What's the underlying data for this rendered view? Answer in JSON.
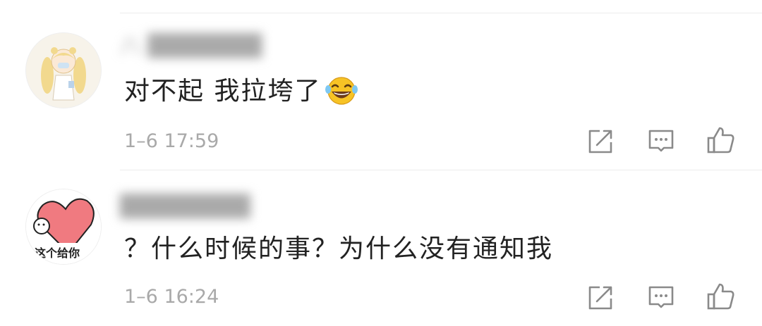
{
  "comments": [
    {
      "username": "八 ███████",
      "text": "对不起 我拉垮了",
      "emoji": "laugh-cry-emoji",
      "time": "1–6 17:59"
    },
    {
      "username": "████████",
      "text": "？什么时候的事？为什么没有通知我",
      "avatar_caption": "这个给你",
      "time": "1–6 16:24"
    }
  ],
  "icons": {
    "share": "share-icon",
    "comment": "comment-icon",
    "like": "thumbs-up-icon"
  },
  "colors": {
    "text": "#222222",
    "muted": "#a9a9a9",
    "heart": "#f07a80",
    "emoji_yellow": "#f7c325"
  }
}
